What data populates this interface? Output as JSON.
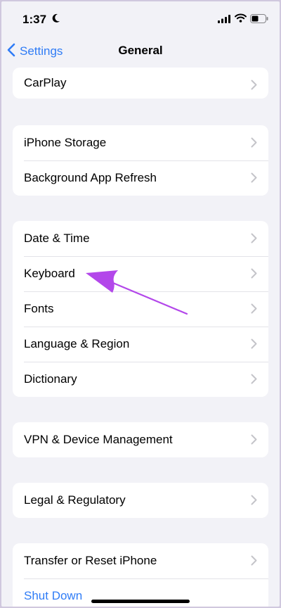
{
  "status_bar": {
    "time": "1:37",
    "icons": [
      "moon-icon",
      "signal-icon",
      "wifi-icon",
      "battery-icon"
    ]
  },
  "nav": {
    "back_label": "Settings",
    "title": "General"
  },
  "groups": {
    "carplay": {
      "items": [
        {
          "label": "CarPlay"
        }
      ]
    },
    "storage": {
      "items": [
        {
          "label": "iPhone Storage"
        },
        {
          "label": "Background App Refresh"
        }
      ]
    },
    "date": {
      "items": [
        {
          "label": "Date & Time"
        },
        {
          "label": "Keyboard"
        },
        {
          "label": "Fonts"
        },
        {
          "label": "Language & Region"
        },
        {
          "label": "Dictionary"
        }
      ]
    },
    "vpn": {
      "items": [
        {
          "label": "VPN & Device Management"
        }
      ]
    },
    "legal": {
      "items": [
        {
          "label": "Legal & Regulatory"
        }
      ]
    },
    "transfer": {
      "items": [
        {
          "label": "Transfer or Reset iPhone"
        },
        {
          "label": "Shut Down"
        }
      ]
    }
  },
  "colors": {
    "accent": "#2f7cf6",
    "annotation_arrow": "#b347ea",
    "background": "#f2f2f7"
  }
}
